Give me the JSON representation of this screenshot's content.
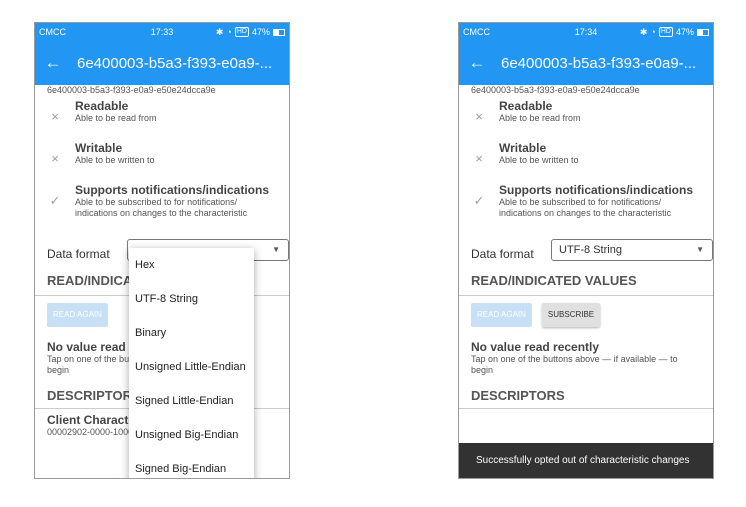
{
  "left": {
    "status": {
      "carrier": "CMCC",
      "time": "17:33",
      "hd": "HD",
      "battery": "47%"
    },
    "title": "6e400003-b5a3-f393-e0a9-...",
    "uuid": "6e400003-b5a3-f393-e0a9-e50e24dcca9e",
    "props": [
      {
        "icon": "×",
        "title": "Readable",
        "desc": "Able to be read from"
      },
      {
        "icon": "×",
        "title": "Writable",
        "desc": "Able to be written to"
      },
      {
        "icon": "✓",
        "title": "Supports notifications/indications",
        "desc1": "Able to be subscribed to for notifications/",
        "desc2": "indications on changes to the characteristic"
      }
    ],
    "data_format_label": "Data format",
    "section_read": "READ/INDICATED VALUES",
    "read_again": "READ AGAIN",
    "no_value_title": "No value read recently",
    "no_value_desc1": "Tap on one of the buttons above — if available — to",
    "no_value_desc2": "begin",
    "descriptors": "DESCRIPTORS",
    "client_title": "Client Characteristic Configuration",
    "client_uuid": "00002902-0000-1000-8000-00805f9b34fb",
    "dropdown": [
      "Hex",
      "UTF-8 String",
      "Binary",
      "Unsigned Little-Endian",
      "Signed Little-Endian",
      "Unsigned Big-Endian",
      "Signed Big-Endian"
    ]
  },
  "right": {
    "status": {
      "carrier": "CMCC",
      "time": "17:34",
      "hd": "HD",
      "battery": "47%"
    },
    "title": "6e400003-b5a3-f393-e0a9-...",
    "uuid": "6e400003-b5a3-f393-e0a9-e50e24dcca9e",
    "props": [
      {
        "icon": "×",
        "title": "Readable",
        "desc": "Able to be read from"
      },
      {
        "icon": "×",
        "title": "Writable",
        "desc": "Able to be written to"
      },
      {
        "icon": "✓",
        "title": "Supports notifications/indications",
        "desc1": "Able to be subscribed to for notifications/",
        "desc2": "indications on changes to the characteristic"
      }
    ],
    "data_format_label": "Data format",
    "data_format_value": "UTF-8 String",
    "section_read": "READ/INDICATED VALUES",
    "read_again": "READ AGAIN",
    "subscribe": "SUBSCRIBE",
    "no_value_title": "No value read recently",
    "no_value_desc1": "Tap on one of the buttons above — if available — to",
    "no_value_desc2": "begin",
    "descriptors": "DESCRIPTORS",
    "toast": "Successfully opted out of characteristic changes"
  },
  "icons": {
    "back": "←",
    "caret": "▼",
    "wifi": "wifi-icon",
    "bluetooth": "bluetooth-icon"
  },
  "colors": {
    "primary": "#2196f3",
    "toast": "#323232"
  }
}
